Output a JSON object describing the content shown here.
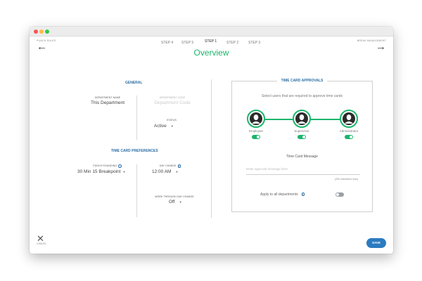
{
  "nav": {
    "back_label": "PUNCH RULES",
    "next_label": "BREAK MANAGEMENT",
    "back_arrow": "←",
    "next_arrow": "→"
  },
  "steps": [
    {
      "label": "STEP 4",
      "active": false
    },
    {
      "label": "STEP 5",
      "active": false
    },
    {
      "label": "STEP 1",
      "active": true
    },
    {
      "label": "STEP 2",
      "active": false
    },
    {
      "label": "STEP 3",
      "active": false
    }
  ],
  "page_title": "Overview",
  "general": {
    "title": "GENERAL",
    "department_name_label": "DEPARTMENT NAME",
    "department_name_value": "This Department",
    "department_code_label": "DEPARTMENT CODE",
    "department_code_placeholder": "Department Code",
    "status_label": "STATUS",
    "status_value": "Active"
  },
  "preferences": {
    "title": "TIME CARD PREFERENCES",
    "punch_rounding_label": "PUNCH ROUNDING",
    "punch_rounding_value": "30 Min 15 Breakpoint",
    "day_change_label": "DAY CHANGE",
    "day_change_value": "12:00 AM",
    "work_through_label": "WORK THROUGH DAY CHANGE",
    "work_through_value": "Off"
  },
  "approvals": {
    "title": "TIME CARD APPROVALS",
    "subtitle": "Select users that are required to approve time cards",
    "roles": [
      {
        "label": "Employee",
        "enabled": true
      },
      {
        "label": "Supervisor",
        "enabled": true
      },
      {
        "label": "Administrator",
        "enabled": true
      }
    ],
    "message_title": "Time Card Message",
    "message_placeholder": "Enter approval message here",
    "char_max": "(250 characters max)",
    "apply_all_label": "Apply to all departments",
    "apply_all_enabled": false
  },
  "footer": {
    "cancel_label": "CANCEL",
    "save_label": "SAVE"
  },
  "colors": {
    "accent_green": "#1cb56b",
    "accent_blue": "#2b7bc1",
    "heading_blue": "#2b6ea6"
  },
  "icons": {
    "info": "i",
    "caret": "▼",
    "close": "✕"
  }
}
